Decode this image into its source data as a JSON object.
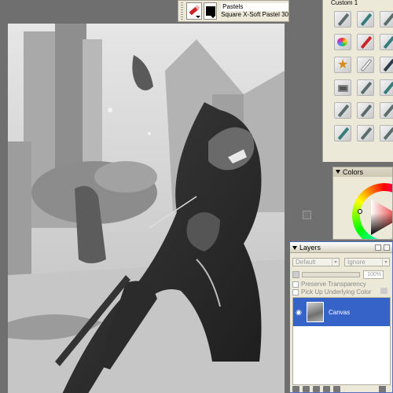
{
  "brush_selector": {
    "category": "Pastels",
    "variant": "Square X-Soft Pastel 30",
    "brush_icon": "pastel-stick-icon",
    "variant_icon": "square-swatch-icon",
    "variant_swatch_color": "#000000"
  },
  "custom_palette": {
    "title": "Custom 1",
    "tools": [
      {
        "icon": "pen-tool-icon",
        "color": "#5b6c6c"
      },
      {
        "icon": "pen-tool-icon",
        "color": "#357c7c"
      },
      {
        "icon": "pen-tool-icon",
        "color": "#5b6c6c"
      },
      {
        "icon": "color-palette-icon",
        "color": "#e33333"
      },
      {
        "icon": "red-pastel-icon",
        "color": "#c9242c"
      },
      {
        "icon": "pen-tool-icon",
        "color": "#357c7c"
      },
      {
        "icon": "star-brush-icon",
        "color": "#d88b16"
      },
      {
        "icon": "white-chalk-icon",
        "color": "#f6f6f6"
      },
      {
        "icon": "dark-pen-icon",
        "color": "#2a3a48"
      },
      {
        "icon": "camera-clone-icon",
        "color": "#555555"
      },
      {
        "icon": "pen-tool-icon",
        "color": "#5b6c6c"
      },
      {
        "icon": "pen-tool-icon",
        "color": "#357c7c"
      },
      {
        "icon": "pen-tool-icon",
        "color": "#5b6c6c"
      },
      {
        "icon": "pen-tool-icon",
        "color": "#5b6c6c"
      },
      {
        "icon": "pen-tool-icon",
        "color": "#5b6c6c"
      },
      {
        "icon": "pen-tool-icon",
        "color": "#357c7c"
      },
      {
        "icon": "pen-tool-icon",
        "color": "#5b6c6c"
      },
      {
        "icon": "pen-tool-icon",
        "color": "#5b6c6c"
      }
    ]
  },
  "colors_panel": {
    "title": "Colors",
    "current_hue": "#e01010"
  },
  "layers_panel": {
    "title": "Layers",
    "composite_method": "Default",
    "composite_depth": "Ignore",
    "opacity": "100%",
    "preserve_transparency_label": "Preserve Transparency",
    "pick_up_underlying_label": "Pick Up Underlying Color",
    "layers": [
      {
        "name": "Canvas",
        "visible": true,
        "selected": true
      }
    ]
  }
}
